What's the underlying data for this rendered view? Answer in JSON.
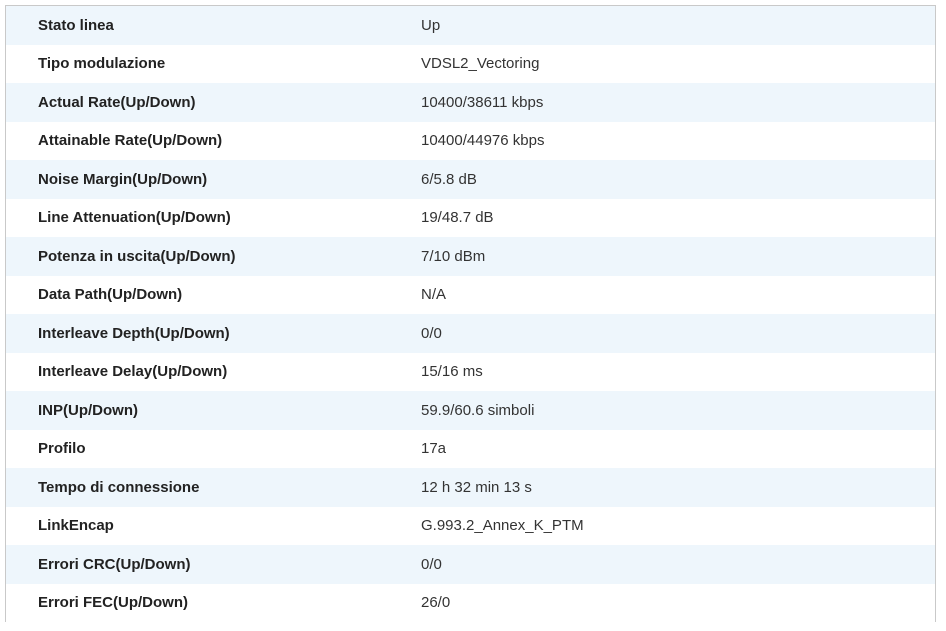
{
  "rows": [
    {
      "label": "Stato linea",
      "value": "Up"
    },
    {
      "label": "Tipo modulazione",
      "value": "VDSL2_Vectoring"
    },
    {
      "label": "Actual Rate(Up/Down)",
      "value": "10400/38611 kbps"
    },
    {
      "label": "Attainable Rate(Up/Down)",
      "value": "10400/44976 kbps"
    },
    {
      "label": "Noise Margin(Up/Down)",
      "value": "6/5.8 dB"
    },
    {
      "label": "Line Attenuation(Up/Down)",
      "value": "19/48.7 dB"
    },
    {
      "label": "Potenza in uscita(Up/Down)",
      "value": "7/10 dBm"
    },
    {
      "label": "Data Path(Up/Down)",
      "value": "N/A"
    },
    {
      "label": "Interleave Depth(Up/Down)",
      "value": "0/0"
    },
    {
      "label": "Interleave Delay(Up/Down)",
      "value": "15/16 ms"
    },
    {
      "label": "INP(Up/Down)",
      "value": "59.9/60.6 simboli"
    },
    {
      "label": "Profilo",
      "value": "17a"
    },
    {
      "label": "Tempo di connessione",
      "value": "12 h 32 min 13 s"
    },
    {
      "label": "LinkEncap",
      "value": "G.993.2_Annex_K_PTM"
    },
    {
      "label": "Errori CRC(Up/Down)",
      "value": "0/0"
    },
    {
      "label": "Errori FEC(Up/Down)",
      "value": "26/0"
    }
  ],
  "colors": {
    "row_stripe": "#eef6fc",
    "row_plain": "#ffffff",
    "border": "#c9c9c9"
  }
}
